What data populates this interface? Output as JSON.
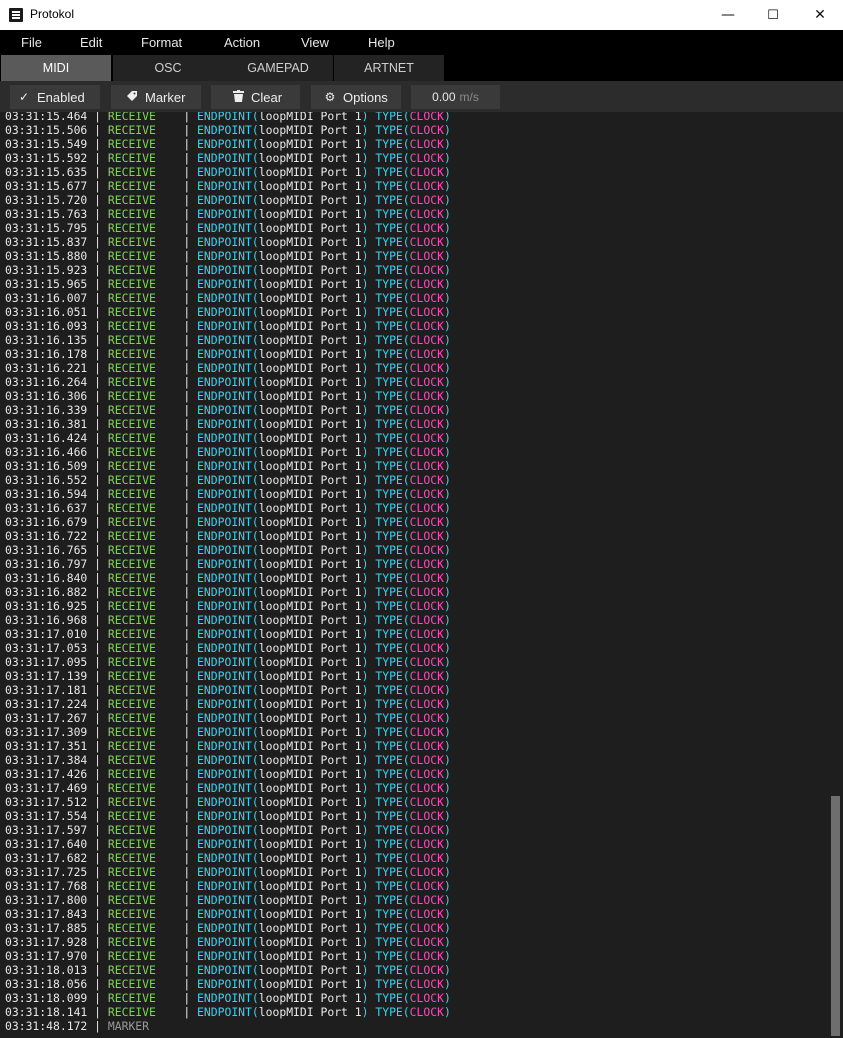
{
  "window": {
    "title": "Protokol",
    "minimize": "—",
    "maximize": "☐",
    "close": "✕"
  },
  "menu": [
    "File",
    "Edit",
    "Format",
    "Action",
    "View",
    "Help"
  ],
  "tabs": [
    "MIDI",
    "OSC",
    "GAMEPAD",
    "ARTNET"
  ],
  "active_tab": "MIDI",
  "toolbar": {
    "enabled_label": "Enabled",
    "enabled_icon": "checkmark-icon",
    "marker_label": "Marker",
    "marker_icon": "tag-icon",
    "clear_label": "Clear",
    "clear_icon": "trash-icon",
    "options_label": "Options",
    "options_icon": "gear-icon",
    "speed_value": "0.00",
    "speed_unit": "m/s"
  },
  "log": {
    "direction": "RECEIVE",
    "endpoint_keyword": "ENDPOINT",
    "endpoint_value": "loopMIDI Port 1",
    "type_keyword": "TYPE",
    "type_value": "CLOCK",
    "timestamps": [
      "03:31:15.464",
      "03:31:15.506",
      "03:31:15.549",
      "03:31:15.592",
      "03:31:15.635",
      "03:31:15.677",
      "03:31:15.720",
      "03:31:15.763",
      "03:31:15.795",
      "03:31:15.837",
      "03:31:15.880",
      "03:31:15.923",
      "03:31:15.965",
      "03:31:16.007",
      "03:31:16.051",
      "03:31:16.093",
      "03:31:16.135",
      "03:31:16.178",
      "03:31:16.221",
      "03:31:16.264",
      "03:31:16.306",
      "03:31:16.339",
      "03:31:16.381",
      "03:31:16.424",
      "03:31:16.466",
      "03:31:16.509",
      "03:31:16.552",
      "03:31:16.594",
      "03:31:16.637",
      "03:31:16.679",
      "03:31:16.722",
      "03:31:16.765",
      "03:31:16.797",
      "03:31:16.840",
      "03:31:16.882",
      "03:31:16.925",
      "03:31:16.968",
      "03:31:17.010",
      "03:31:17.053",
      "03:31:17.095",
      "03:31:17.139",
      "03:31:17.181",
      "03:31:17.224",
      "03:31:17.267",
      "03:31:17.309",
      "03:31:17.351",
      "03:31:17.384",
      "03:31:17.426",
      "03:31:17.469",
      "03:31:17.512",
      "03:31:17.554",
      "03:31:17.597",
      "03:31:17.640",
      "03:31:17.682",
      "03:31:17.725",
      "03:31:17.768",
      "03:31:17.800",
      "03:31:17.843",
      "03:31:17.885",
      "03:31:17.928",
      "03:31:17.970",
      "03:31:18.013",
      "03:31:18.056",
      "03:31:18.099",
      "03:31:18.141"
    ],
    "marker_row": {
      "timestamp": "03:31:48.172",
      "label": "MARKER"
    }
  },
  "colors": {
    "receive": "#7fd35a",
    "keyword": "#3fd0ee",
    "value": "#f24fb7",
    "marker": "#9a9a9a",
    "background": "#1e1e1e"
  }
}
